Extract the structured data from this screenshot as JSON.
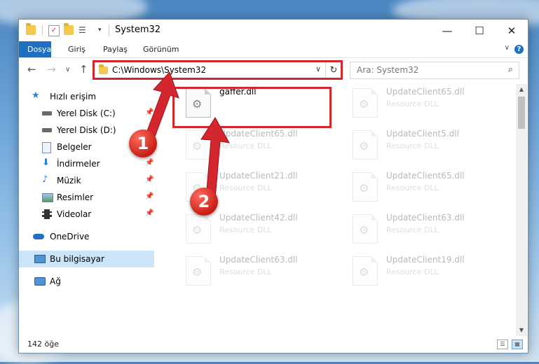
{
  "window": {
    "title": "System32",
    "controls": {
      "minimize": "—",
      "maximize": "☐",
      "close": "✕"
    }
  },
  "ribbon": {
    "tabs": [
      "Dosya",
      "Giriş",
      "Paylaş",
      "Görünüm"
    ],
    "help": "?",
    "collapse": "∨"
  },
  "address": {
    "path": "C:\\Windows\\System32",
    "dropdown": "∨",
    "refresh": "↻"
  },
  "search": {
    "placeholder": "Ara: System32",
    "icon": "⌕"
  },
  "nav": {
    "back": "←",
    "forward": "→",
    "recent": "∨",
    "up": "↑"
  },
  "sidebar": {
    "items": [
      {
        "label": "Hızlı erişim",
        "icon": "star-icon",
        "pin": ""
      },
      {
        "label": "Yerel Disk (C:)",
        "icon": "drive-icon",
        "pin": "📌"
      },
      {
        "label": "Yerel Disk (D:)",
        "icon": "drive-icon",
        "pin": ""
      },
      {
        "label": "Belgeler",
        "icon": "documents-icon",
        "pin": "📌"
      },
      {
        "label": "İndirmeler",
        "icon": "download-icon",
        "pin": "📌"
      },
      {
        "label": "Müzik",
        "icon": "music-icon",
        "pin": "📌"
      },
      {
        "label": "Resimler",
        "icon": "pictures-icon",
        "pin": "📌"
      },
      {
        "label": "Videolar",
        "icon": "videos-icon",
        "pin": "📌"
      },
      {
        "label": "OneDrive",
        "icon": "cloud-icon",
        "pin": ""
      },
      {
        "label": "Bu bilgisayar",
        "icon": "computer-icon",
        "pin": ""
      },
      {
        "label": "Ağ",
        "icon": "network-icon",
        "pin": ""
      }
    ]
  },
  "files": [
    {
      "name": "gaffer.dll",
      "type": ""
    },
    {
      "name": "UpdateClient65.dll",
      "type": "Resource DLL"
    },
    {
      "name": "UpdateClient65.dll",
      "type": "Resource DLL"
    },
    {
      "name": "UpdateClient5.dll",
      "type": "Resource DLL"
    },
    {
      "name": "UpdateClient21.dll",
      "type": "Resource DLL"
    },
    {
      "name": "UpdateClient65.dll",
      "type": "Resource DLL"
    },
    {
      "name": "UpdateClient42.dll",
      "type": "Resource DLL"
    },
    {
      "name": "UpdateClient63.dll",
      "type": "Resource DLL"
    },
    {
      "name": "UpdateClient63.dll",
      "type": "Resource DLL"
    },
    {
      "name": "UpdateClient19.dll",
      "type": "Resource DLL"
    }
  ],
  "status": {
    "count": "142 öğe"
  },
  "annotations": {
    "step1": "1",
    "step2": "2",
    "color": "#d3262e"
  }
}
